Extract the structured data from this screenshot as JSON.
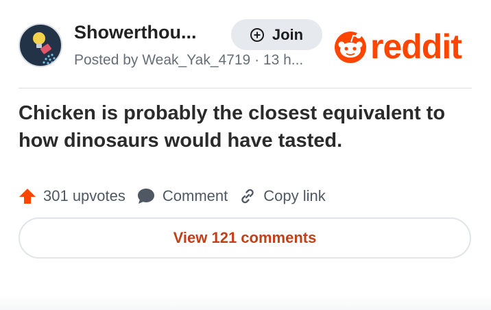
{
  "post": {
    "subreddit": "Showerthou...",
    "posted_by": "Posted by Weak_Yak_4719 · 13 h...",
    "join_label": "Join",
    "title": "Chicken is probably the closest equivalent to how dinosaurs would have tasted."
  },
  "brand": {
    "logo_text": "reddit",
    "color": "#ff4500"
  },
  "actions": {
    "upvotes_label": "301 upvotes",
    "comment_label": "Comment",
    "copy_link_label": "Copy link"
  },
  "view_comments_label": "View 121 comments",
  "icons": [
    "subreddit-avatar-icon",
    "plus-circle-icon",
    "reddit-snoo-icon",
    "upvote-arrow-icon",
    "comment-bubble-icon",
    "link-icon"
  ],
  "colors": {
    "accent": "#ff4500",
    "view_comments_text": "#c0401a",
    "muted_text": "#666f78"
  }
}
